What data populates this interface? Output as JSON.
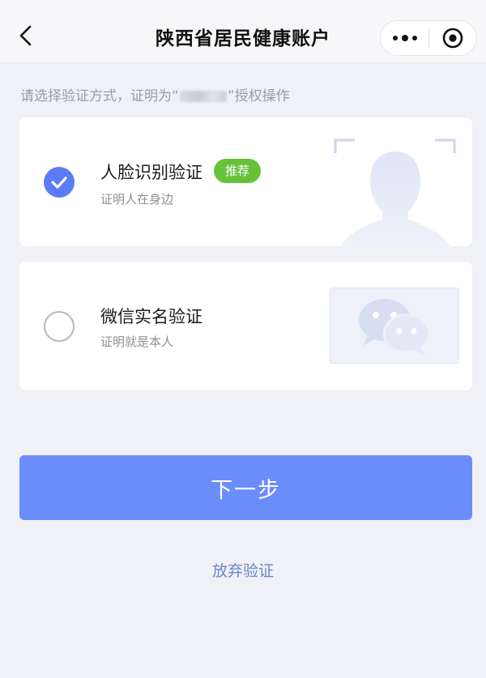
{
  "nav": {
    "title": "陕西省居民健康账户",
    "back_icon": "chevron-left-icon",
    "more_icon": "more-dots-icon",
    "close_icon": "record-target-icon"
  },
  "hint": {
    "prefix": "请选择验证方式，证明为“",
    "suffix": "”授权操作"
  },
  "options": [
    {
      "title": "人脸识别验证",
      "badge": "推荐",
      "subtitle": "证明人在身边",
      "selected": true,
      "icon": "face-portrait-icon"
    },
    {
      "title": "微信实名验证",
      "subtitle": "证明就是本人",
      "selected": false,
      "icon": "wechat-bubbles-icon"
    }
  ],
  "actions": {
    "next_label": "下一步",
    "abandon_label": "放弃验证"
  },
  "colors": {
    "accent": "#5b7cf6",
    "button": "#6b8cfb",
    "badge": "#67c23a",
    "link": "#6d86c9"
  }
}
